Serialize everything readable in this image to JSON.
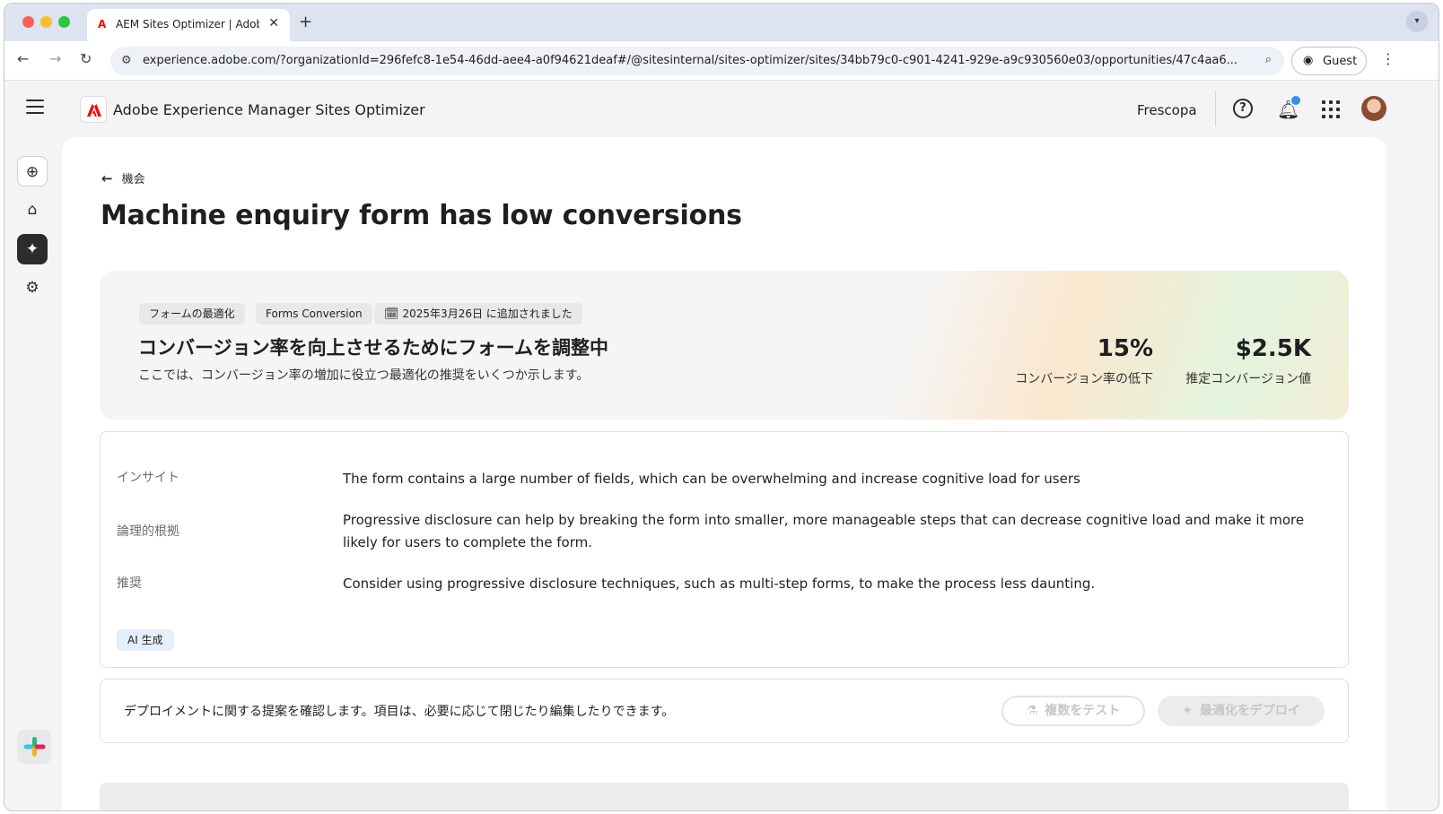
{
  "browser": {
    "tab_title": "AEM Sites Optimizer | Adobe",
    "tab_logo": "A",
    "url": "experience.adobe.com/?organizationId=296fefc8-1e54-46dd-aee4-a0f94621deaf#/@sitesinternal/sites-optimizer/sites/34bb79c0-c901-4241-929e-a9c930560e03/opportunities/47c4aa6...",
    "guest_label": "Guest"
  },
  "header": {
    "app_title": "Adobe Experience Manager Sites Optimizer",
    "org_name": "Frescopa",
    "help_glyph": "?"
  },
  "page": {
    "back_label": "機会",
    "title": "Machine enquiry form has low conversions"
  },
  "hero": {
    "tags": [
      "フォームの最適化",
      "Forms Conversion",
      "2025年3月26日 に追加されました"
    ],
    "title": "コンバージョン率を向上させるためにフォームを調整中",
    "subtitle": "ここでは、コンバージョン率の増加に役立つ最適化の推奨をいくつか示します。",
    "metrics": [
      {
        "value": "15%",
        "label": "コンバージョン率の低下"
      },
      {
        "value": "$2.5K",
        "label": "推定コンバージョン値"
      }
    ]
  },
  "insights": {
    "rows": [
      {
        "label": "インサイト",
        "text": "The form contains a large number of fields, which can be overwhelming and increase cognitive load for users"
      },
      {
        "label": "論理的根拠",
        "text": "Progressive disclosure can help by breaking the form into smaller, more manageable steps that can decrease cognitive load and make it more likely for users to complete the form."
      },
      {
        "label": "推奨",
        "text": "Consider using progressive disclosure techniques, such as multi-step forms, to make the process less daunting."
      }
    ],
    "ai_badge": "AI 生成"
  },
  "deploy": {
    "text": "デプロイメントに関する提案を確認します。項目は、必要に応じて閉じたり編集したりできます。",
    "test_button": "複数をテスト",
    "deploy_button": "最適化をデプロイ"
  },
  "icons": {
    "rail": [
      "globe-icon",
      "home-icon",
      "opportunities-icon",
      "settings-icon",
      "slack-icon"
    ]
  },
  "colors": {
    "accent_red": "#eb1000",
    "notification_dot": "#378ef0",
    "rail_active": "#2c2c2c"
  }
}
